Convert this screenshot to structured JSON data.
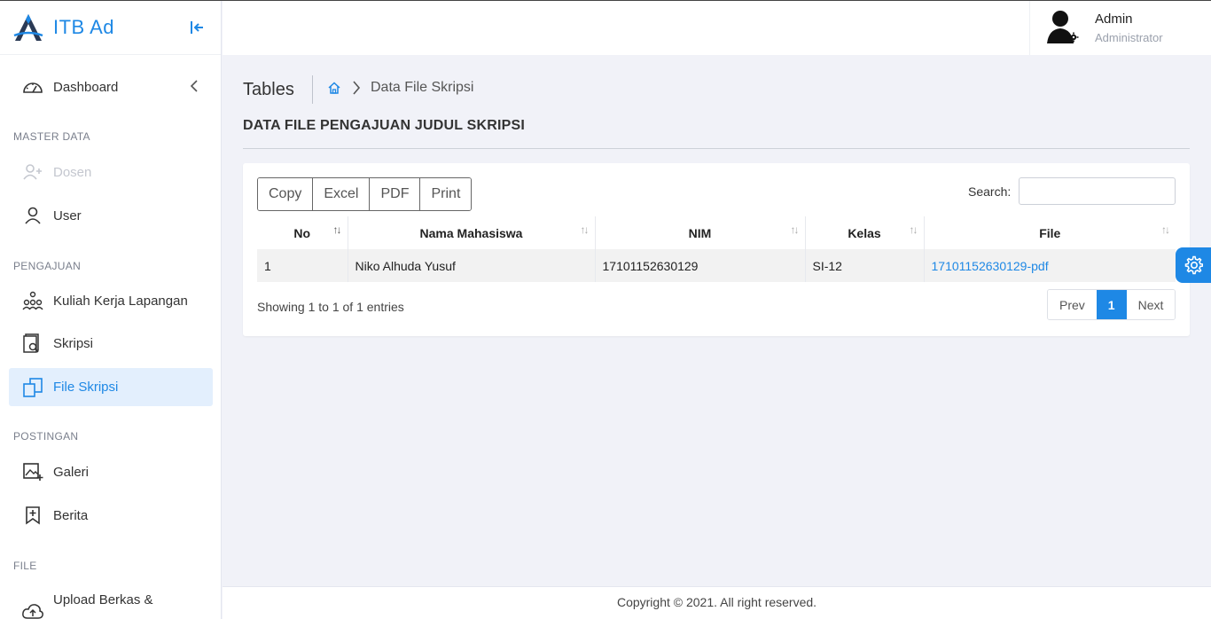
{
  "brand": {
    "name": "ITB Ad"
  },
  "sidebar": {
    "items": [
      {
        "label": "Dashboard"
      },
      {
        "label": "Dosen"
      },
      {
        "label": "User"
      },
      {
        "label": "Kuliah Kerja Lapangan"
      },
      {
        "label": "Skripsi"
      },
      {
        "label": "File Skripsi"
      },
      {
        "label": "Galeri"
      },
      {
        "label": "Berita"
      },
      {
        "label": "Upload Berkas &"
      }
    ],
    "sections": [
      "MASTER DATA",
      "PENGAJUAN",
      "POSTINGAN",
      "FILE"
    ]
  },
  "user": {
    "name": "Admin",
    "role": "Administrator"
  },
  "page": {
    "title": "Tables",
    "breadcrumb": "Data File Skripsi",
    "section_title": "DATA FILE PENGAJUAN JUDUL SKRIPSI"
  },
  "table": {
    "buttons": [
      "Copy",
      "Excel",
      "PDF",
      "Print"
    ],
    "search_label": "Search:",
    "columns": [
      "No",
      "Nama Mahasiswa",
      "NIM",
      "Kelas",
      "File"
    ],
    "rows": [
      [
        "1",
        "Niko Alhuda Yusuf",
        "17101152630129",
        "SI-12",
        "17101152630129-pdf"
      ]
    ],
    "info": "Showing 1 to 1 of 1 entries",
    "pagination": {
      "prev": "Prev",
      "current": "1",
      "next": "Next"
    }
  },
  "footer": {
    "text": "Copyright © 2021. All right reserved."
  },
  "colors": {
    "accent": "#1e88e5",
    "active_bg": "#e3effd"
  }
}
